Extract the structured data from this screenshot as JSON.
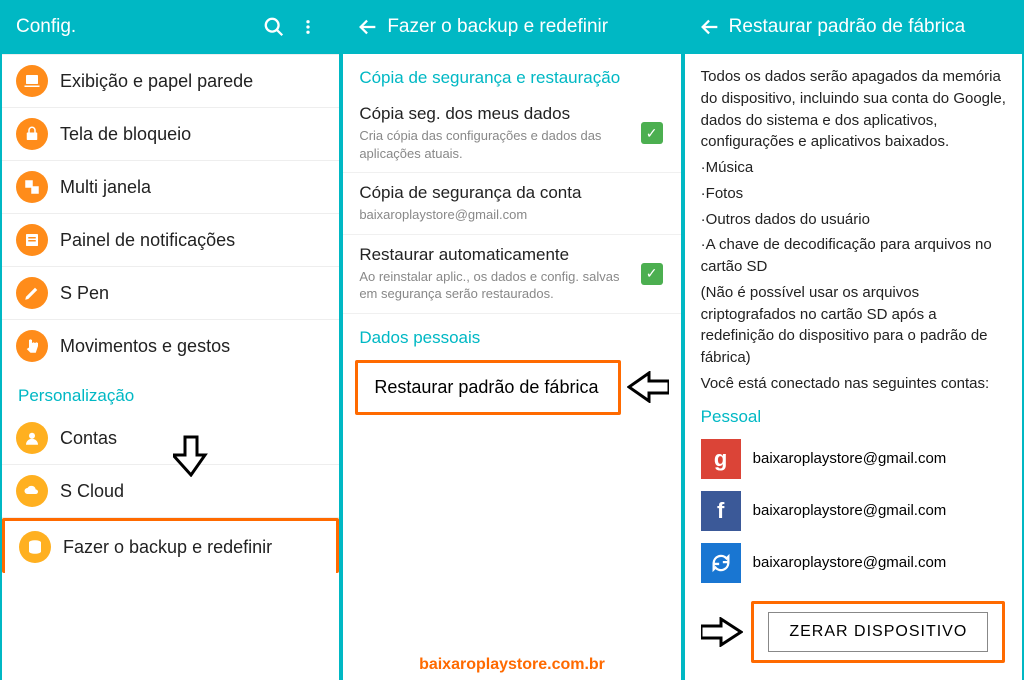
{
  "panel1": {
    "title": "Config.",
    "items": [
      {
        "label": "Exibição e papel parede"
      },
      {
        "label": "Tela de bloqueio"
      },
      {
        "label": "Multi janela"
      },
      {
        "label": "Painel de notificações"
      },
      {
        "label": "S Pen"
      },
      {
        "label": "Movimentos e gestos"
      }
    ],
    "section": "Personalização",
    "items2": [
      {
        "label": "Contas"
      },
      {
        "label": "S Cloud"
      },
      {
        "label": "Fazer o backup e redefinir"
      }
    ]
  },
  "panel2": {
    "title": "Fazer o backup e redefinir",
    "section1": "Cópia de segurança e restauração",
    "rows": [
      {
        "t": "Cópia seg. dos meus dados",
        "s": "Cria cópia das configurações e dados das aplicações atuais.",
        "chk": true
      },
      {
        "t": "Cópia de segurança da conta",
        "s": "baixaroplaystore@gmail.com",
        "chk": false
      },
      {
        "t": "Restaurar automaticamente",
        "s": "Ao reinstalar aplic., os dados e config. salvas em segurança serão restaurados.",
        "chk": true
      }
    ],
    "section2": "Dados pessoais",
    "factory": "Restaurar padrão de fábrica",
    "watermark": "baixaroplaystore.com.br"
  },
  "panel3": {
    "title": "Restaurar padrão de fábrica",
    "intro": "Todos os dados serão apagados da memória do dispositivo, incluindo sua conta do Google, dados do sistema e dos aplicativos, configurações e aplicativos baixados.",
    "bullets": [
      "·Música",
      "·Fotos",
      "·Outros dados do usuário",
      "·A chave de decodificação para arquivos no cartão SD"
    ],
    "note": "(Não é possível usar os arquivos criptografados no cartão SD após a redefinição do dispositivo para o padrão de fábrica)",
    "connected": "Você está conectado nas seguintes contas:",
    "personal": "Pessoal",
    "accounts": [
      {
        "type": "g",
        "email": "baixaroplaystore@gmail.com"
      },
      {
        "type": "fb",
        "email": "baixaroplaystore@gmail.com"
      },
      {
        "type": "sy",
        "email": "baixaroplaystore@gmail.com"
      }
    ],
    "reset_btn": "ZERAR DISPOSITIVO"
  }
}
